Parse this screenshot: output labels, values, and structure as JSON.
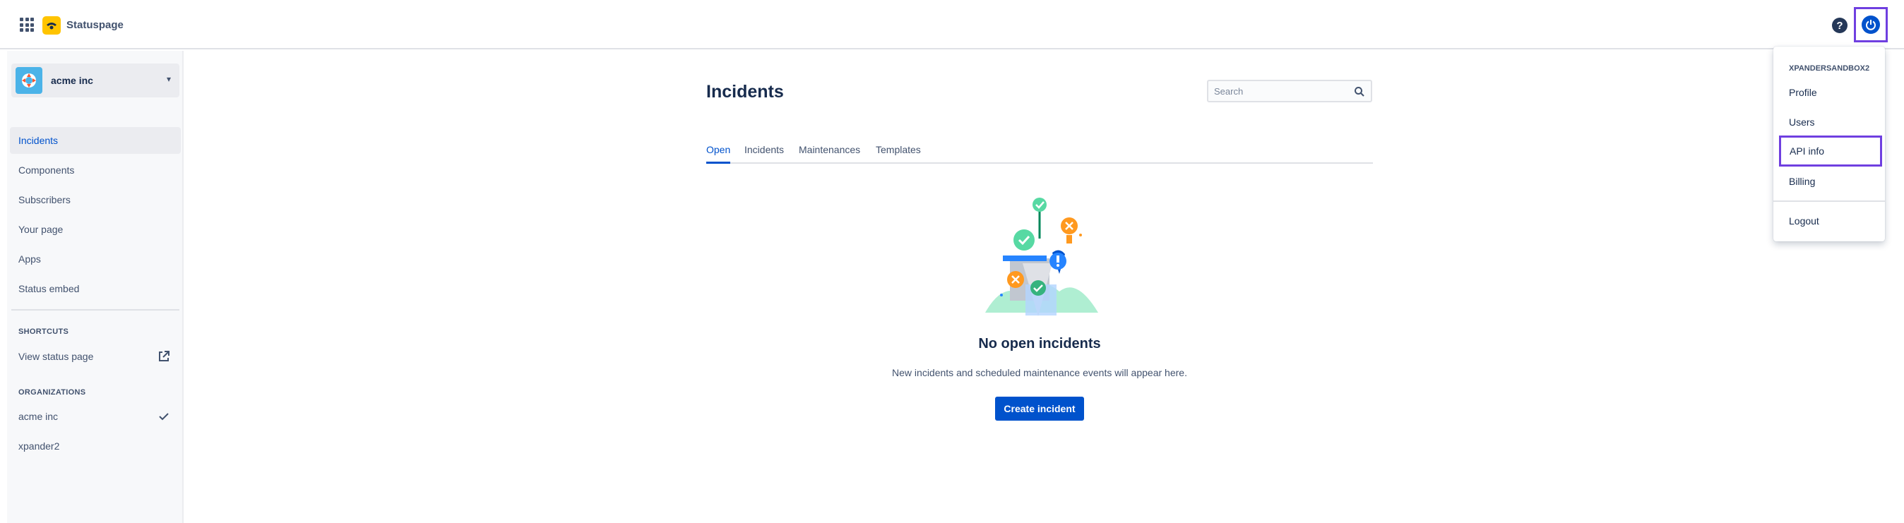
{
  "header": {
    "brand": "Statuspage"
  },
  "sidebar": {
    "org": {
      "name": "acme inc"
    },
    "nav": [
      {
        "label": "Incidents",
        "active": true
      },
      {
        "label": "Components",
        "active": false
      },
      {
        "label": "Subscribers",
        "active": false
      },
      {
        "label": "Your page",
        "active": false
      },
      {
        "label": "Apps",
        "active": false
      },
      {
        "label": "Status embed",
        "active": false
      }
    ],
    "shortcuts": {
      "heading": "SHORTCUTS",
      "items": [
        {
          "label": "View status page",
          "icon": "external-link-icon"
        }
      ]
    },
    "organizations": {
      "heading": "ORGANIZATIONS",
      "items": [
        {
          "label": "acme inc",
          "selected": true,
          "icon": "check-icon"
        },
        {
          "label": "xpander2",
          "selected": false
        }
      ]
    }
  },
  "main": {
    "title": "Incidents",
    "search": {
      "placeholder": "Search",
      "value": ""
    },
    "tabs": [
      {
        "label": "Open",
        "active": true
      },
      {
        "label": "Incidents",
        "active": false
      },
      {
        "label": "Maintenances",
        "active": false
      },
      {
        "label": "Templates",
        "active": false
      }
    ],
    "empty_state": {
      "title": "No open incidents",
      "description": "New incidents and scheduled maintenance events will appear here.",
      "button": "Create incident"
    }
  },
  "user_menu": {
    "heading": "XPANDERSANDBOX2",
    "items": [
      {
        "label": "Profile"
      },
      {
        "label": "Users"
      },
      {
        "label": "API info",
        "highlighted": true
      },
      {
        "label": "Billing"
      },
      {
        "label": "Logout"
      }
    ]
  },
  "colors": {
    "primary": "#0052cc",
    "highlight_outline": "#6f3fe0",
    "brand_yellow": "#ffc400",
    "text_dark": "#172b4d",
    "text_subtle": "#42526e",
    "sidebar_bg": "#f7f8fa"
  }
}
